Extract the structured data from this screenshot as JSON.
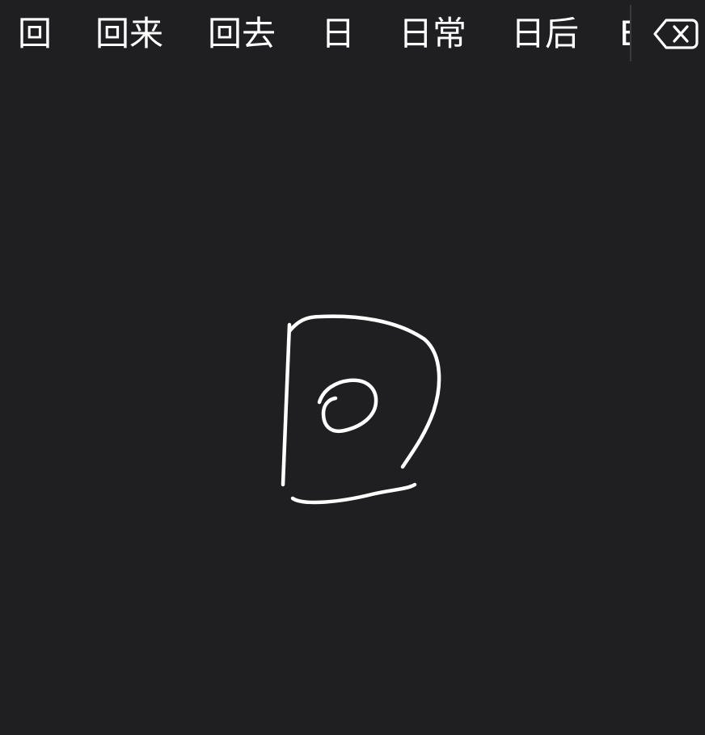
{
  "candidate_bar": {
    "candidates": [
      {
        "label": "回"
      },
      {
        "label": "回来"
      },
      {
        "label": "回去"
      },
      {
        "label": "日"
      },
      {
        "label": "日常"
      },
      {
        "label": "日后"
      },
      {
        "label": "E"
      }
    ],
    "delete_icon": "backspace-delete-icon"
  },
  "handwriting": {
    "stroke_color": "#ffffff",
    "background_color": "#1f1e21"
  }
}
